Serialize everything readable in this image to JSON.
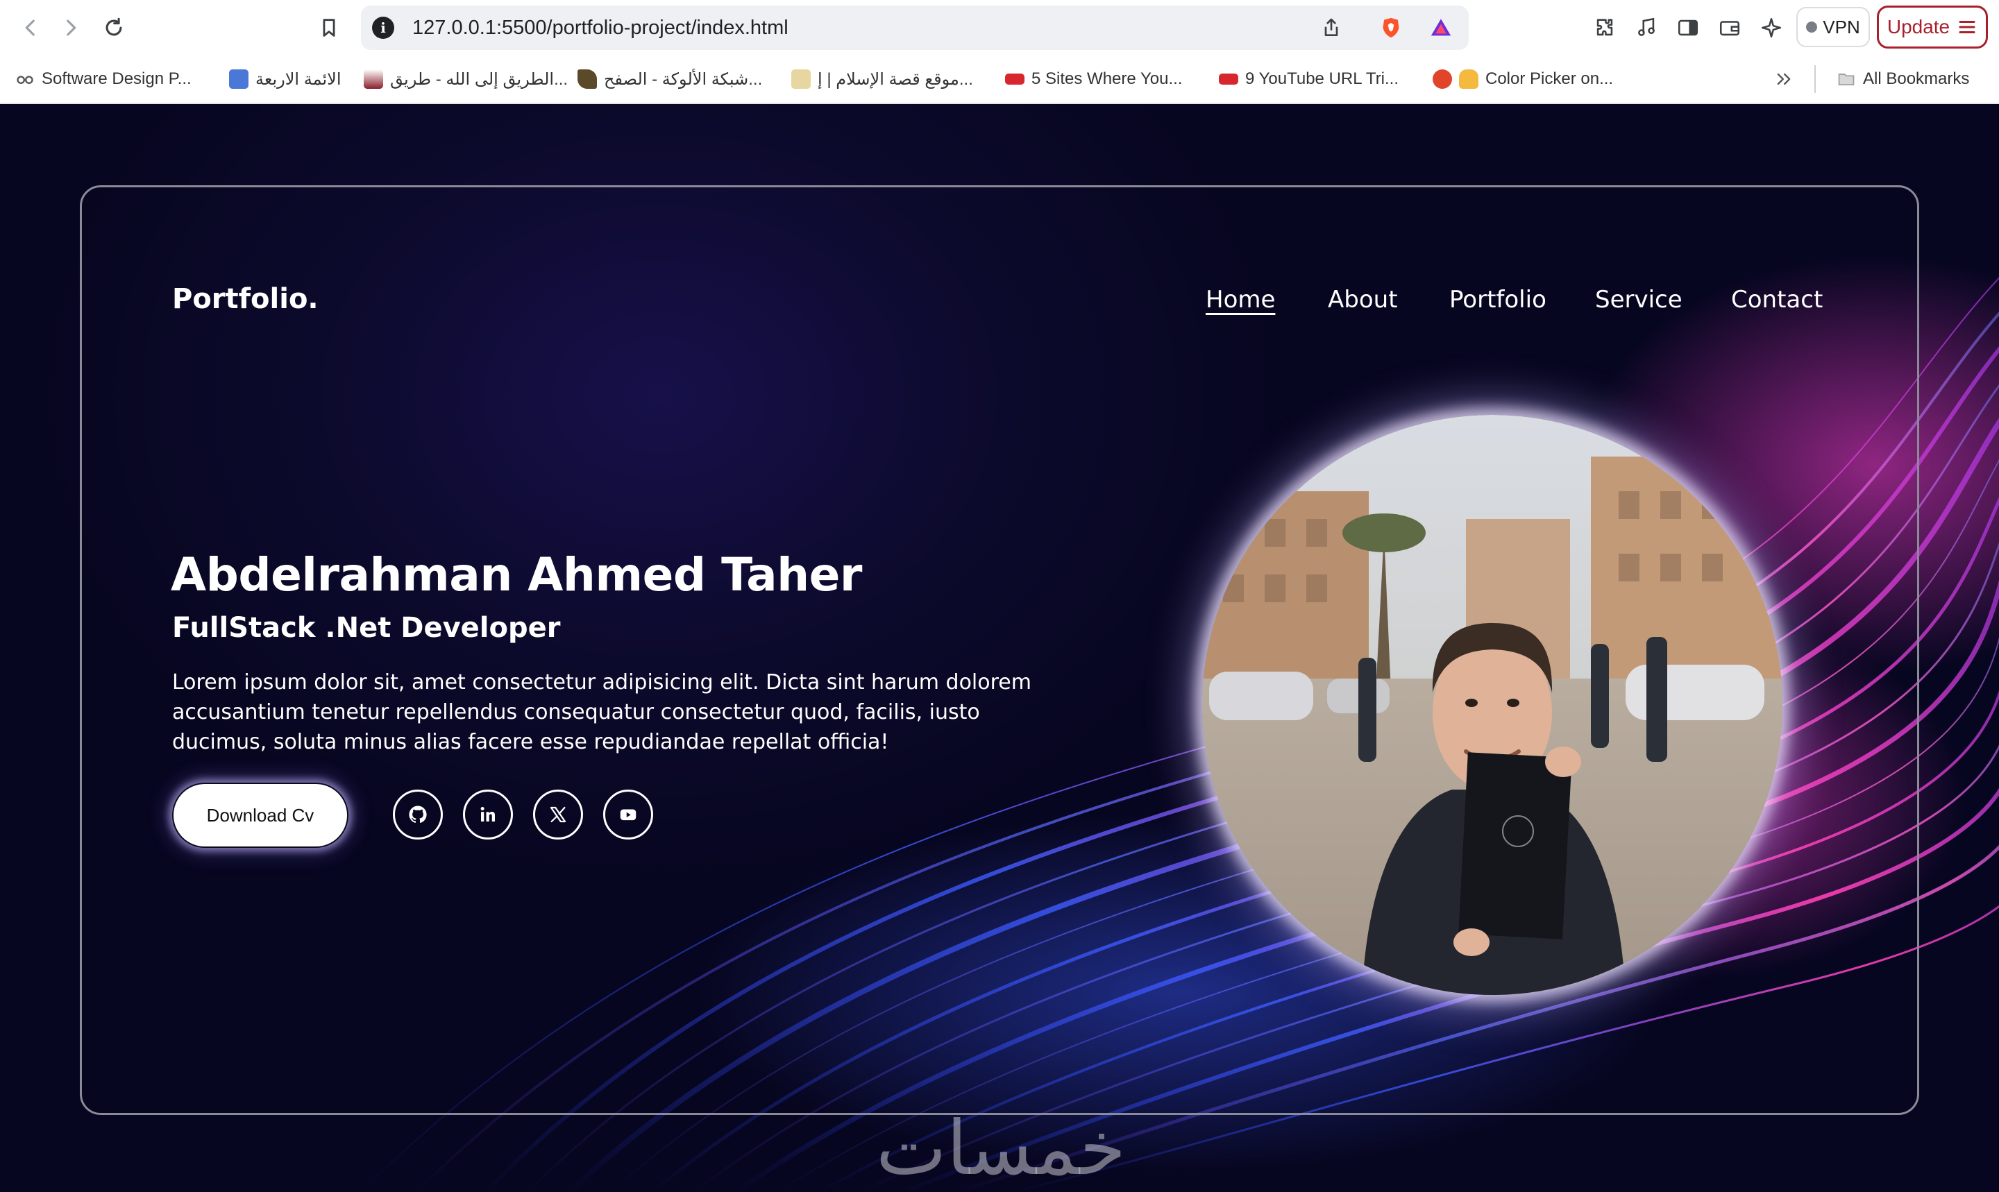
{
  "browser": {
    "url": "127.0.0.1:5500/portfolio-project/index.html",
    "vpn_label": "VPN",
    "update_label": "Update",
    "bookmarks": [
      {
        "label": "Software Design P..."
      },
      {
        "label": "الائمة الاربعة"
      },
      {
        "label": "الطريق إلى الله - طريق..."
      },
      {
        "label": "شبكة الألوكة - الصفح..."
      },
      {
        "label": "موقع قصة الإسلام | إ..."
      },
      {
        "label": "5 Sites Where You..."
      },
      {
        "label": "9 YouTube URL Tri..."
      },
      {
        "label": "Color Picker on..."
      }
    ],
    "all_bookmarks_label": "All Bookmarks"
  },
  "page": {
    "logo": "Portfolio.",
    "nav": [
      {
        "label": "Home",
        "active": true
      },
      {
        "label": "About"
      },
      {
        "label": "Portfolio"
      },
      {
        "label": "Service"
      },
      {
        "label": "Contact"
      }
    ],
    "hero": {
      "name": "Abdelrahman Ahmed Taher",
      "role": "FullStack .Net Developer",
      "description": "Lorem ipsum dolor sit, amet consectetur adipisicing elit. Dicta sint harum dolorem accusantium tenetur repellendus consequatur consectetur quod, facilis, iusto ducimus, soluta minus alias facere esse repudiandae repellat officia!",
      "cta_label": "Download Cv"
    },
    "social_icons": [
      "github-icon",
      "linkedin-icon",
      "x-icon",
      "youtube-icon"
    ],
    "watermark": "خمسات"
  },
  "colors": {
    "background": "#0c0a2c",
    "text": "#ffffff",
    "frame_border": "#8b8a99",
    "update_accent": "#a8202c",
    "wave_pink": "#ff3fb4",
    "wave_blue": "#4a6bff"
  }
}
